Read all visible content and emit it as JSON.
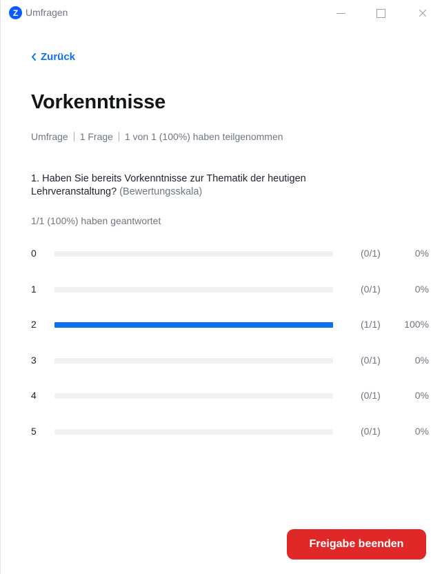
{
  "window": {
    "app_logo": "Z",
    "title": "Umfragen",
    "minimize_icon": "minimize-icon",
    "maximize_icon": "maximize-icon",
    "close_icon": "close-icon",
    "close_glyph": "✕"
  },
  "nav": {
    "back_chevron": "‹",
    "back_label": "Zurück"
  },
  "poll": {
    "title": "Vorkenntnisse",
    "meta": [
      "Umfrage",
      "1 Frage",
      "1 von 1 (100%) haben teilgenommen"
    ],
    "question_text": "1. Haben Sie bereits Vorkenntnisse zur Thematik der heutigen Lehrveranstaltung?",
    "question_type": "(Bewertungsskala)",
    "answered_summary": "1/1 (100%) haben geantwortet",
    "results": [
      {
        "label": "0",
        "count": "(0/1)",
        "percent_text": "0%",
        "share": 0
      },
      {
        "label": "1",
        "count": "(0/1)",
        "percent_text": "0%",
        "share": 0
      },
      {
        "label": "2",
        "count": "(1/1)",
        "percent_text": "100%",
        "share": 1
      },
      {
        "label": "3",
        "count": "(0/1)",
        "percent_text": "0%",
        "share": 0
      },
      {
        "label": "4",
        "count": "(0/1)",
        "percent_text": "0%",
        "share": 0
      },
      {
        "label": "5",
        "count": "(0/1)",
        "percent_text": "0%",
        "share": 0
      }
    ]
  },
  "footer": {
    "end_button_label": "Freigabe beenden"
  },
  "colors": {
    "accent": "#0e72ed",
    "danger": "#e02828",
    "track": "#f1f1f4"
  }
}
